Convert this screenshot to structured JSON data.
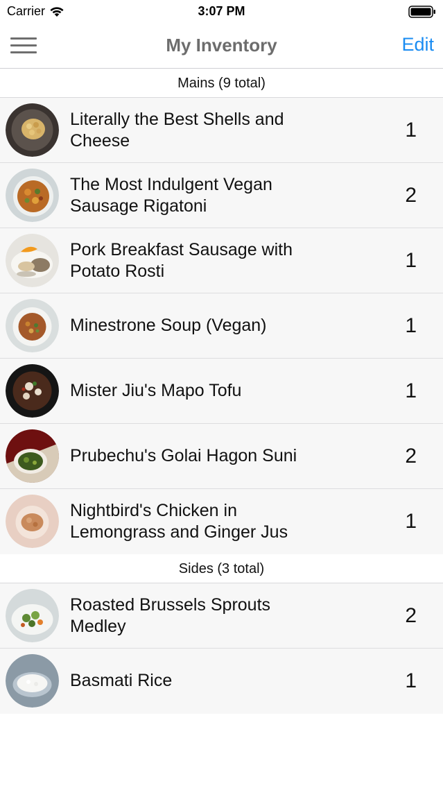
{
  "status_bar": {
    "carrier": "Carrier",
    "time": "3:07 PM",
    "wifi_icon": "wifi-icon",
    "battery_icon": "battery-icon"
  },
  "nav": {
    "menu_icon": "hamburger-menu-icon",
    "title": "My Inventory",
    "edit_label": "Edit",
    "accent_color": "#1a8cf2"
  },
  "sections": [
    {
      "header": "Mains (9 total)",
      "items": [
        {
          "name": "Literally the Best Shells and Cheese",
          "qty": "1"
        },
        {
          "name": "The Most Indulgent Vegan Sausage Rigatoni",
          "qty": "2"
        },
        {
          "name": "Pork Breakfast Sausage with Potato Rosti",
          "qty": "1"
        },
        {
          "name": "Minestrone Soup (Vegan)",
          "qty": "1"
        },
        {
          "name": "Mister Jiu's Mapo Tofu",
          "qty": "1"
        },
        {
          "name": "Prubechu's Golai Hagon Suni",
          "qty": "2"
        },
        {
          "name": "Nightbird's Chicken in Lemongrass and Ginger Jus",
          "qty": "1"
        }
      ]
    },
    {
      "header": "Sides (3 total)",
      "items": [
        {
          "name": "Roasted Brussels Sprouts Medley",
          "qty": "2"
        },
        {
          "name": "Basmati Rice",
          "qty": "1"
        }
      ]
    }
  ]
}
